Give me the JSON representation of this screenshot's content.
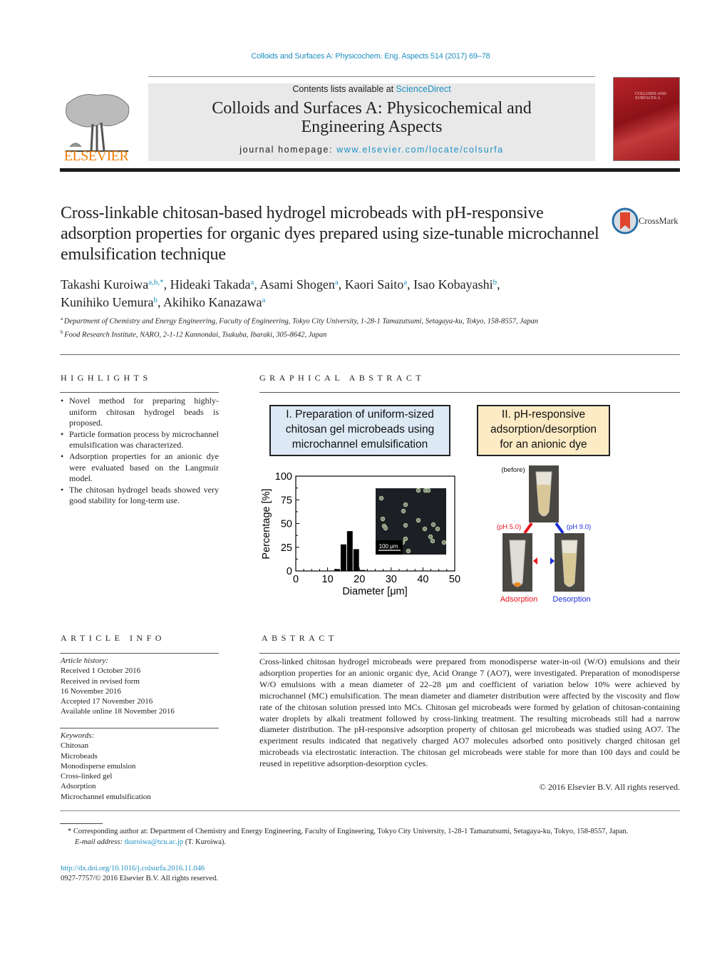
{
  "header": {
    "citation": "Colloids and Surfaces A: Physicochem. Eng. Aspects 514 (2017) 69–78",
    "contents_prefix": "Contents lists available at ",
    "contents_link": "ScienceDirect",
    "journal_title_line1": "Colloids and Surfaces A: Physicochemical and",
    "journal_title_line2": "Engineering Aspects",
    "homepage_prefix": "journal homepage: ",
    "homepage_link": "www.elsevier.com/locate/colsurfa",
    "publisher_logo_text": "ELSEVIER",
    "cover_text": "COLLOIDS AND SURFACES A"
  },
  "article": {
    "title": "Cross-linkable chitosan-based hydrogel microbeads with pH-responsive adsorption properties for organic dyes prepared using size-tunable microchannel emulsification technique",
    "crossmark_label": "CrossMark",
    "authors": [
      {
        "name": "Takashi Kuroiwa",
        "sup": "a,b,*"
      },
      {
        "name": "Hideaki Takada",
        "sup": "a"
      },
      {
        "name": "Asami Shogen",
        "sup": "a"
      },
      {
        "name": "Kaori Saito",
        "sup": "a"
      },
      {
        "name": "Isao Kobayashi",
        "sup": "b"
      },
      {
        "name": "Kunihiko Uemura",
        "sup": "b"
      },
      {
        "name": "Akihiko Kanazawa",
        "sup": "a"
      }
    ],
    "affiliations": [
      {
        "mark": "a",
        "text": "Department of Chemistry and Energy Engineering, Faculty of Engineering, Tokyo City University, 1-28-1 Tamazutsumi, Setagaya-ku, Tokyo, 158-8557, Japan"
      },
      {
        "mark": "b",
        "text": "Food Research Institute, NARO, 2-1-12 Kannondai, Tsukuba, Ibaraki, 305-8642, Japan"
      }
    ]
  },
  "highlights": {
    "heading": "HIGHLIGHTS",
    "items": [
      "Novel method for preparing highly-uniform chitosan hydrogel beads is proposed.",
      "Particle formation process by microchannel emulsification was characterized.",
      "Adsorption properties for an anionic dye were evaluated based on the Langmuir model.",
      "The chitosan hydrogel beads showed very good stability for long-term use."
    ]
  },
  "graphical_abstract": {
    "heading": "GRAPHICAL ABSTRACT",
    "box1": [
      "I. Preparation of uniform-sized",
      "chitosan gel microbeads using",
      "microchannel emulsification"
    ],
    "box2": [
      "II. pH-responsive",
      "adsorption/desorption",
      "for an anionic dye"
    ],
    "inset_scale_label": "100 μm",
    "tubes": {
      "before": "(before)",
      "ph_low": "(pH 5.0)",
      "ph_high": "(pH 9.0)",
      "adsorption": "Adsorption",
      "desorption": "Desorption",
      "adsorption_color": "#e8141c",
      "desorption_color": "#1c2fd6"
    }
  },
  "chart_data": {
    "type": "bar",
    "title": "",
    "xlabel": "Diameter [μm]",
    "ylabel": "Percentage [%]",
    "xlim": [
      0,
      50
    ],
    "ylim": [
      0,
      100
    ],
    "xticks": [
      0,
      10,
      20,
      30,
      40,
      50
    ],
    "yticks": [
      0,
      25,
      50,
      75,
      100
    ],
    "grid": false,
    "bins": [
      {
        "from": 12,
        "to": 14,
        "value": 2
      },
      {
        "from": 14,
        "to": 16,
        "value": 28
      },
      {
        "from": 16,
        "to": 18,
        "value": 42
      },
      {
        "from": 18,
        "to": 20,
        "value": 23
      },
      {
        "from": 20,
        "to": 22,
        "value": 1
      }
    ]
  },
  "article_info": {
    "heading": "ARTICLE INFO",
    "history_label": "Article history:",
    "history": [
      "Received 1 October 2016",
      "Received in revised form",
      "16 November 2016",
      "Accepted 17 November 2016",
      "Available online 18 November 2016"
    ],
    "keywords_label": "Keywords:",
    "keywords": [
      "Chitosan",
      "Microbeads",
      "Monodisperse emulsion",
      "Cross-linked gel",
      "Adsorption",
      "Microchannel emulsification"
    ]
  },
  "abstract": {
    "heading": "ABSTRACT",
    "text": "Cross-linked chitosan hydrogel microbeads were prepared from monodisperse water-in-oil (W/O) emulsions and their adsorption properties for an anionic organic dye, Acid Orange 7 (AO7), were investigated. Preparation of monodisperse W/O emulsions with a mean diameter of 22–28 μm and coefficient of variation below 10% were achieved by microchannel (MC) emulsification. The mean diameter and diameter distribution were affected by the viscosity and flow rate of the chitosan solution pressed into MCs. Chitosan gel microbeads were formed by gelation of chitosan-containing water droplets by alkali treatment followed by cross-linking treatment. The resulting microbeads still had a narrow diameter distribution. The pH-responsive adsorption property of chitosan gel microbeads was studied using AO7. The experiment results indicated that negatively charged AO7 molecules adsorbed onto positively charged chitosan gel microbeads via electrostatic interaction. The chitosan gel microbeads were stable for more than 100 days and could be reused in repetitive adsorption-desorption cycles.",
    "copyright": "© 2016 Elsevier B.V. All rights reserved."
  },
  "footer": {
    "corresponding": "* Corresponding author at: Department of Chemistry and Energy Engineering, Faculty of Engineering, Tokyo City University, 1-28-1 Tamazutsumi, Setagaya-ku, Tokyo, 158-8557, Japan.",
    "email_label": "E-mail address: ",
    "email": "tkuroiwa@tcu.ac.jp",
    "email_suffix": " (T. Kuroiwa).",
    "doi": "http://dx.doi.org/10.1016/j.colsurfa.2016.11.046",
    "issn": "0927-7757/© 2016 Elsevier B.V. All rights reserved."
  }
}
